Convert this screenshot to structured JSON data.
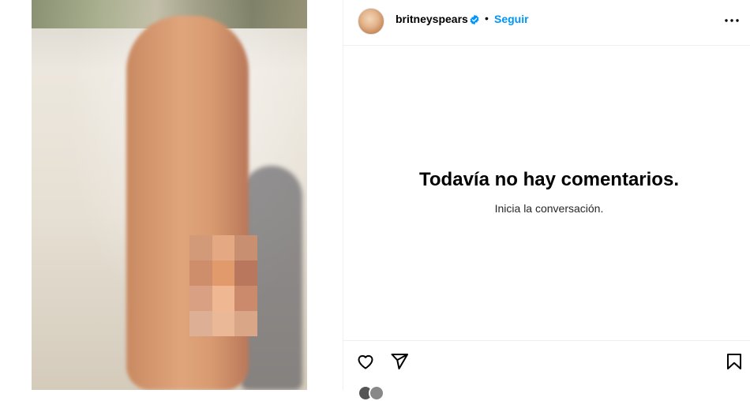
{
  "post": {
    "username": "britneyspears",
    "separator": "•",
    "follow_label": "Seguir",
    "verified": true
  },
  "comments": {
    "empty_title": "Todavía no hay comentarios.",
    "empty_subtitle": "Inicia la conversación."
  },
  "icons": {
    "verified": "verified-badge-icon",
    "more": "more-options-icon",
    "like": "heart-icon",
    "share": "paper-plane-icon",
    "save": "bookmark-icon"
  },
  "colors": {
    "accent": "#0095f6",
    "text": "#000000",
    "divider": "#efefef"
  }
}
